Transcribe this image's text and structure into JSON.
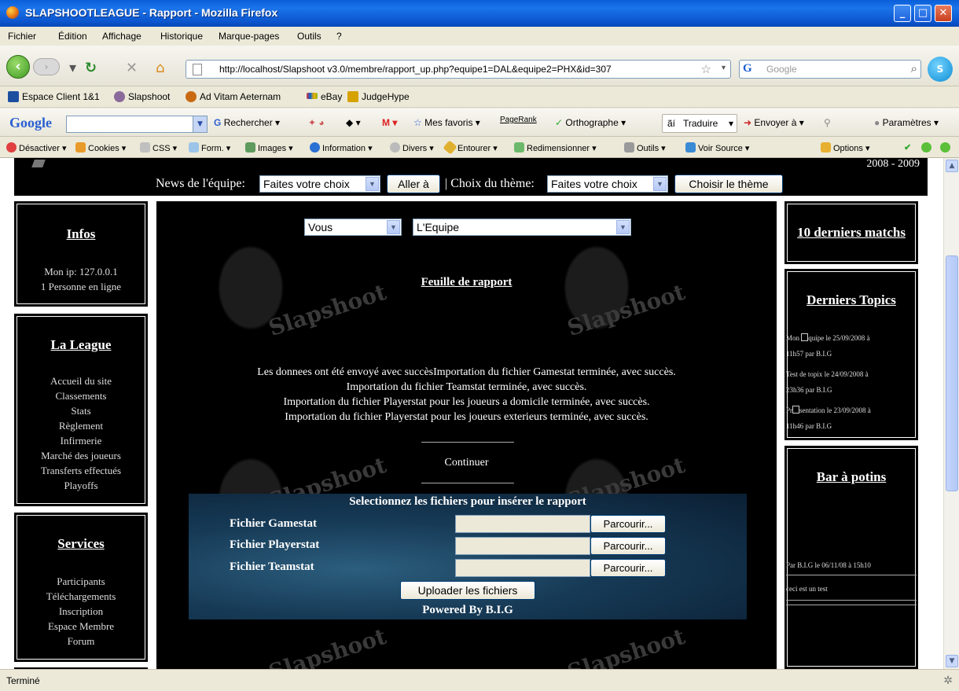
{
  "window": {
    "title": "SLAPSHOOTLEAGUE - Rapport - Mozilla Firefox",
    "minimize": "_",
    "maximize": "□",
    "close": "✕"
  },
  "menu": [
    "Fichier",
    "Édition",
    "Affichage",
    "Historique",
    "Marque-pages",
    "Outils",
    "?"
  ],
  "nav": {
    "url": "http://localhost/Slapshoot v3.0/membre/rapport_up.php?equipe1=DAL&equipe2=PHX&id=307",
    "search_placeholder": "Google"
  },
  "bookmarks": [
    "Espace Client 1&1",
    "Slapshoot",
    "Ad Vitam Aeternam",
    "eBay",
    "JudgeHype"
  ],
  "google_toolbar": {
    "logo": "Google",
    "search": "Rechercher",
    "favorites": "Mes favoris",
    "pagerank": "PageRank",
    "spelling": "Orthographe",
    "translate": "Traduire",
    "send": "Envoyer à",
    "settings": "Paramètres"
  },
  "dev_toolbar": [
    "Désactiver",
    "Cookies",
    "CSS",
    "Form.",
    "Images",
    "Information",
    "Divers",
    "Entourer",
    "Redimensionner",
    "Outils",
    "Voir Source",
    "Options"
  ],
  "topstrip": {
    "season": "2008 - 2009",
    "news_label": "News de l'équipe:",
    "news_select": "Faites votre choix",
    "go_button": "Aller à",
    "theme_label": "| Choix du thème:",
    "theme_select": "Faites votre choix",
    "theme_button": "Choisir le thème"
  },
  "left": {
    "infos": {
      "title": "Infos",
      "lines": [
        "Mon ip: 127.0.0.1",
        "1 Personne en ligne"
      ]
    },
    "league": {
      "title": "La League",
      "items": [
        "Accueil du site",
        "Classements",
        "Stats",
        "Règlement",
        "Infirmerie",
        "Marché des joueurs",
        "Transferts effectués",
        "Playoffs"
      ]
    },
    "services": {
      "title": "Services",
      "items": [
        "Participants",
        "Téléchargements",
        "Inscription",
        "Espace Membre",
        "Forum"
      ]
    }
  },
  "center": {
    "select_from": "Vous",
    "select_to": "L'Equipe",
    "title": "Feuille de rapport",
    "messages": [
      "Les donnees ont été envoyé avec succèsImportation du fichier Gamestat terminée, avec succès.",
      "Importation du fichier Teamstat terminée, avec succès.",
      "Importation du fichier Playerstat pour les joueurs a domicile terminée, avec succès.",
      "Importation du fichier Playerstat pour les joueurs exterieurs terminée, avec succès."
    ],
    "continue": "Continuer",
    "upload": {
      "heading": "Selectionnez les fichiers pour insérer le rapport",
      "files": [
        {
          "label": "Fichier Gamestat",
          "button": "Parcourir..."
        },
        {
          "label": "Fichier Playerstat",
          "button": "Parcourir..."
        },
        {
          "label": "Fichier Teamstat",
          "button": "Parcourir..."
        }
      ],
      "submit": "Uploader les fichiers",
      "powered": "Powered By B.I.G"
    },
    "watermark": "Slapshoot"
  },
  "right": {
    "last_matches": "10 derniers matchs",
    "topics_title": "Derniers Topics",
    "topics": [
      {
        "pre": "Mon ",
        "post": "quipe le 25/09/2008 à",
        "line2": "11h57 par B.I.G"
      },
      {
        "pre": "Test de topix le 24/09/2008 à",
        "post": "",
        "line2": "23h36 par B.I.G"
      },
      {
        "pre": "Pr",
        "post": "sentation le 23/09/2008 à",
        "line2": "11h46 par B.I.G"
      }
    ],
    "bar_title": "Bar à potins",
    "bar_post": "Par B.I.G le 06/11/08 à 15h10",
    "bar_text": "ceci est un test"
  },
  "status": "Terminé"
}
